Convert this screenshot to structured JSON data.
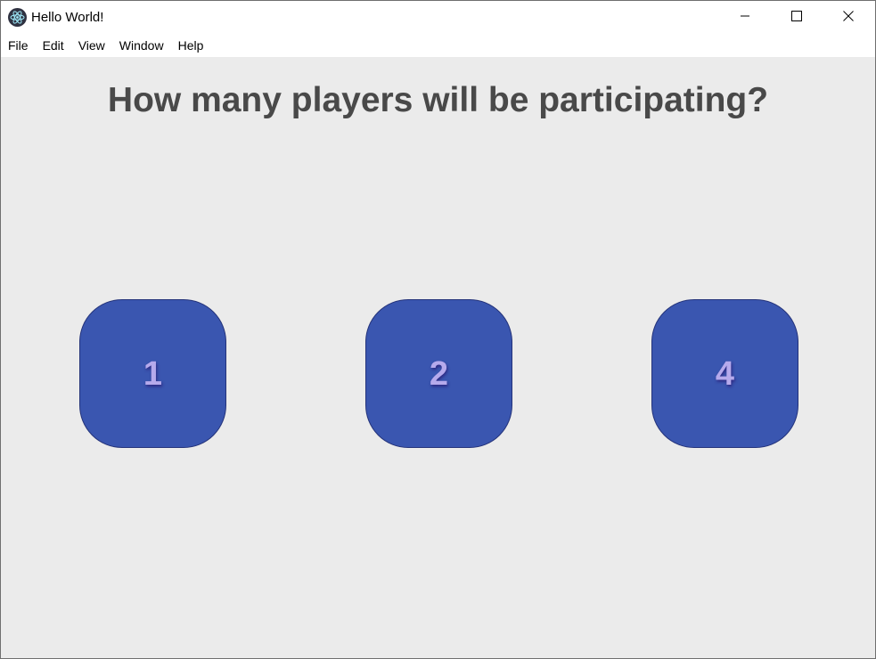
{
  "window": {
    "title": "Hello World!",
    "controls": [
      "minimize",
      "maximize",
      "close"
    ]
  },
  "menu": {
    "items": [
      {
        "label": "File"
      },
      {
        "label": "Edit"
      },
      {
        "label": "View"
      },
      {
        "label": "Window"
      },
      {
        "label": "Help"
      }
    ]
  },
  "main": {
    "heading": "How many players will be participating?",
    "options": [
      {
        "label": "1"
      },
      {
        "label": "2"
      },
      {
        "label": "4"
      }
    ]
  },
  "colors": {
    "background": "#ebebeb",
    "heading_text": "#494949",
    "button_fill": "#3a56b0",
    "button_text": "#b6aaec"
  },
  "icons": {
    "app": "electron-atom-icon",
    "minimize": "minimize-icon",
    "maximize": "maximize-icon",
    "close": "close-icon"
  }
}
